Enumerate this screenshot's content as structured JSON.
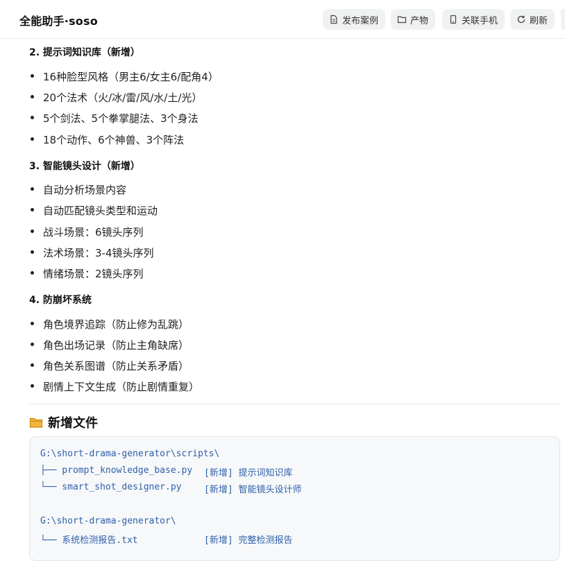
{
  "header": {
    "title": "全能助手·soso",
    "buttons": [
      {
        "label": "发布案例",
        "icon": "document-icon"
      },
      {
        "label": "产物",
        "icon": "folder-icon"
      },
      {
        "label": "关联手机",
        "icon": "phone-icon"
      },
      {
        "label": "刷新",
        "icon": "refresh-icon"
      }
    ]
  },
  "sections": [
    {
      "heading": "2. 提示词知识库（新增）",
      "items": [
        "16种脸型风格（男主6/女主6/配角4）",
        "20个法术（火/冰/雷/风/水/土/光）",
        "5个剑法、5个拳掌腿法、3个身法",
        "18个动作、6个神兽、3个阵法"
      ]
    },
    {
      "heading": "3. 智能镜头设计（新增）",
      "items": [
        "自动分析场景内容",
        "自动匹配镜头类型和运动",
        "战斗场景：6镜头序列",
        "法术场景：3-4镜头序列",
        "情绪场景：2镜头序列"
      ]
    },
    {
      "heading": "4. 防崩坏系统",
      "items": [
        "角色境界追踪（防止修为乱跳）",
        "角色出场记录（防止主角缺席）",
        "角色关系图谱（防止关系矛盾）",
        "剧情上下文生成（防止剧情重复）"
      ]
    }
  ],
  "new_files": {
    "title": "新增文件",
    "lines": [
      {
        "path": "G:\\short-drama-generator\\scripts\\",
        "note": ""
      },
      {
        "path": "├── prompt_knowledge_base.py",
        "note": "[新增] 提示词知识库"
      },
      {
        "path": "└── smart_shot_designer.py",
        "note": "[新增] 智能镜头设计师"
      },
      {
        "path": "",
        "note": ""
      },
      {
        "path": "G:\\short-drama-generator\\",
        "note": ""
      },
      {
        "path": "└── 系统检测报告.txt",
        "note": "[新增] 完整检测报告"
      }
    ]
  }
}
